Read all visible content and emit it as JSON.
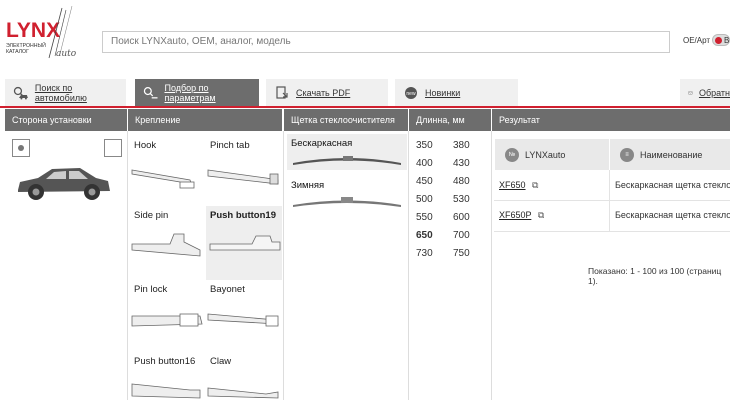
{
  "logo": {
    "brand": "LYNX",
    "script": "auto",
    "tagline_1": "ЭЛЕКТРОННЫЙ",
    "tagline_2": "КАТАЛОГ"
  },
  "search": {
    "placeholder": "Поиск LYNXauto, OEM, аналог, модель"
  },
  "oe_toggle": {
    "label": "OE/Арт",
    "state_text": "ВК"
  },
  "tabs": [
    {
      "label": "Поиск по автомобилю",
      "icon": "car-search-icon",
      "active": false
    },
    {
      "label": "Подбор по параметрам",
      "icon": "parameters-search-icon",
      "active": true
    },
    {
      "label": "Скачать PDF",
      "icon": "pdf-icon",
      "active": false
    },
    {
      "label": "Новинки",
      "icon": "new-items-icon",
      "active": false
    },
    {
      "label": "Обратн",
      "icon": "feedback-icon",
      "active": false
    }
  ],
  "columns": {
    "side": "Сторона установки",
    "mount": "Крепление",
    "wiper": "Щетка стеклоочистителя",
    "length": "Длинна, мм",
    "result": "Результат"
  },
  "mounts": [
    {
      "label": "Hook",
      "selected": false
    },
    {
      "label": "Pinch tab",
      "selected": false
    },
    {
      "label": "Side pin",
      "selected": false
    },
    {
      "label": "Push button19",
      "selected": true
    },
    {
      "label": "Pin lock",
      "selected": false
    },
    {
      "label": "Bayonet",
      "selected": false
    },
    {
      "label": "Push button16",
      "selected": false
    },
    {
      "label": "Claw",
      "selected": false
    }
  ],
  "wipers": [
    {
      "label": "Бескаркасная",
      "selected": true
    },
    {
      "label": "Зимняя",
      "selected": false
    }
  ],
  "lengths": [
    "350",
    "380",
    "400",
    "430",
    "450",
    "480",
    "500",
    "530",
    "550",
    "600",
    "650",
    "700",
    "730",
    "750"
  ],
  "selected_length": "650",
  "result": {
    "head_code": "LYNXauto",
    "head_name": "Наименование",
    "badge_code": "№",
    "rows": [
      {
        "code": "XF650",
        "name": "Бескаркасная щетка стеклоочи"
      },
      {
        "code": "XF650P",
        "name": "Бескаркасная щетка стеклоочи"
      }
    ],
    "pager": "Показано: 1 - 100 из 100 (страниц 1)."
  },
  "colors": {
    "accent": "#d0202f",
    "header_gray": "#6d6d6d",
    "tab_bg": "#f0f0f0"
  }
}
